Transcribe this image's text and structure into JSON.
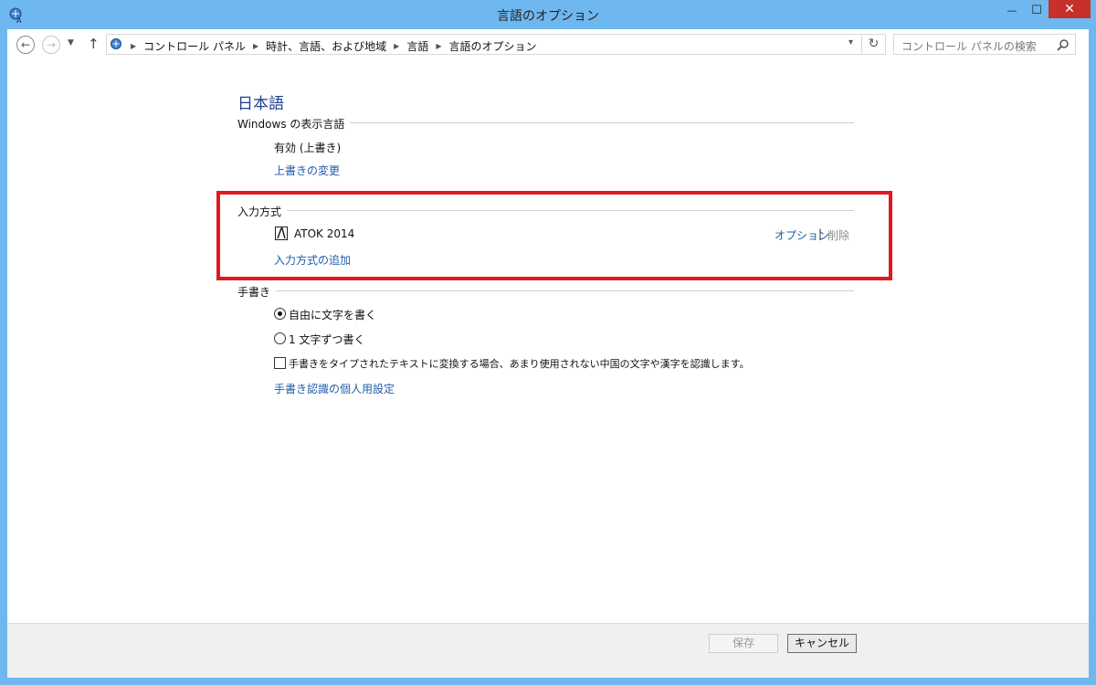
{
  "window": {
    "title": "言語のオプション",
    "close_glyph": "✕",
    "min_glyph": "—",
    "max_glyph": "☐"
  },
  "nav": {
    "breadcrumbs": [
      "コントロール パネル",
      "時計、言語、および地域",
      "言語",
      "言語のオプション"
    ],
    "search_placeholder": "コントロール パネルの検索"
  },
  "page": {
    "language_heading": "日本語",
    "display_language": {
      "label": "Windows の表示言語",
      "status": "有効 (上書き)",
      "change_link": "上書きの変更"
    },
    "input_method": {
      "label": "入力方式",
      "ime_name": "ATOK 2014",
      "options_link": "オプション",
      "separator": "|",
      "remove_link": "削除",
      "add_link": "入力方式の追加"
    },
    "handwriting": {
      "label": "手書き",
      "option_free": "自由に文字を書く",
      "option_single": "1 文字ずつ書く",
      "selected": "free",
      "checkbox_label": "手書きをタイプされたテキストに変換する場合、あまり使用されない中国の文字や漢字を認識します。",
      "checkbox_checked": false,
      "personalize_link": "手書き認識の個人用設定"
    }
  },
  "footer": {
    "save_label": "保存",
    "cancel_label": "キャンセル"
  },
  "colors": {
    "frame": "#6fb7ef",
    "link": "#1f5ca8",
    "heading": "#1e3e8a",
    "highlight": "#e01921",
    "close_button": "#c7312b"
  },
  "icons": {
    "app": "control-panel-icon",
    "back": "back-arrow-icon",
    "forward": "forward-arrow-icon",
    "up": "up-arrow-icon",
    "refresh": "refresh-icon",
    "search": "search-icon",
    "ime": "atok-icon"
  }
}
